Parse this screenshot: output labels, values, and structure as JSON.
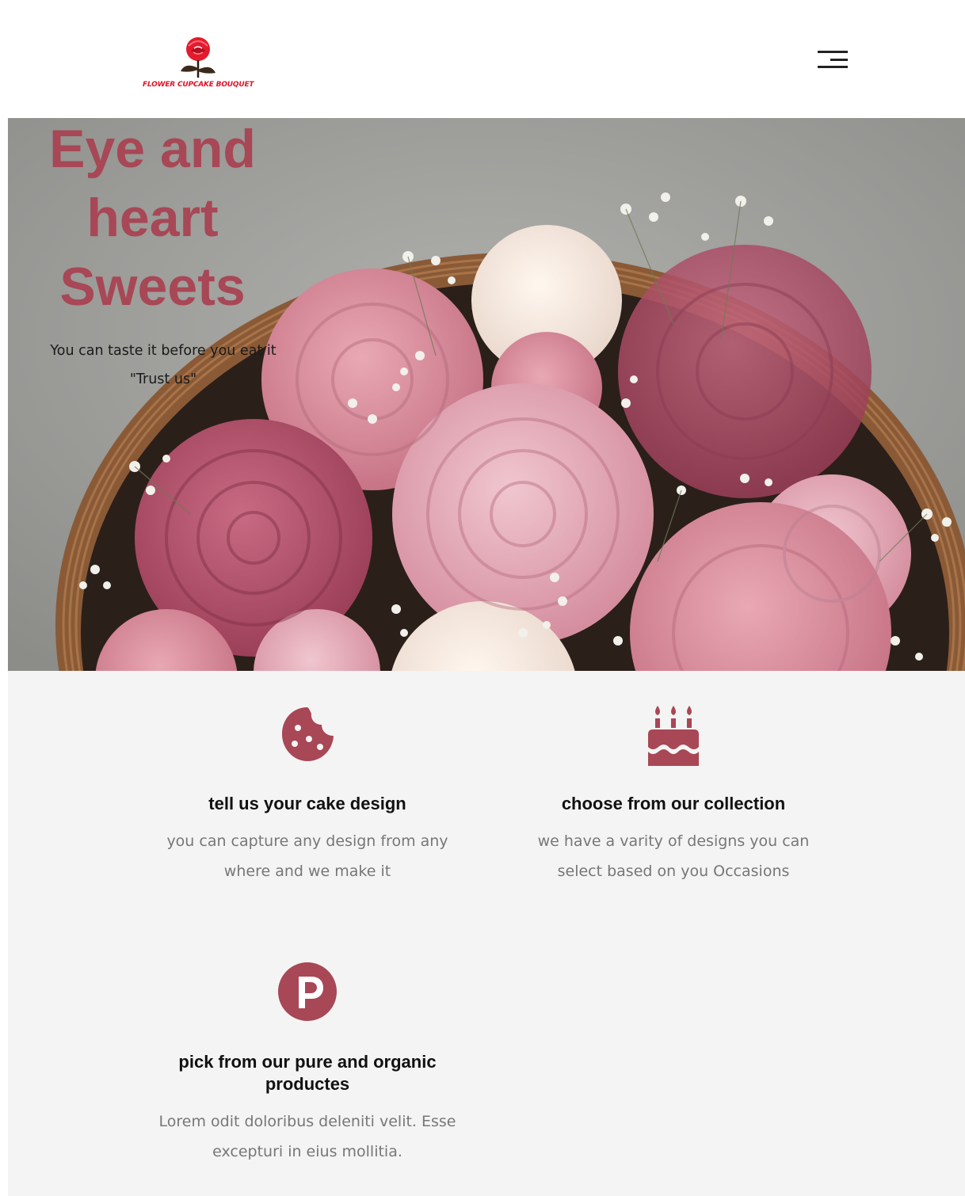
{
  "header": {
    "logo_text": "FLOWER CUPCAKE BOUQUET",
    "menu_icon": "hamburger-menu-icon"
  },
  "hero": {
    "title": "Eye and heart Sweets",
    "subtitle_line1": "You can taste it before you eat it",
    "subtitle_line2": "\"Trust us\""
  },
  "features": [
    {
      "icon": "cookie-icon",
      "title": "tell us your cake design",
      "text": "you can capture any design from any where and we make it"
    },
    {
      "icon": "birthday-cake-icon",
      "title": "choose from our collection",
      "text": "we have a varity of designs you can select based on you Occasions"
    },
    {
      "icon": "parking-p-icon",
      "title": "pick from our pure and organic productes",
      "text": "Lorem odit doloribus deleniti velit. Esse excepturi in eius mollitia."
    }
  ],
  "colors": {
    "accent": "#a84755",
    "logo_red": "#e0142a",
    "feature_bg": "#f4f4f4",
    "body_text": "#777777"
  }
}
